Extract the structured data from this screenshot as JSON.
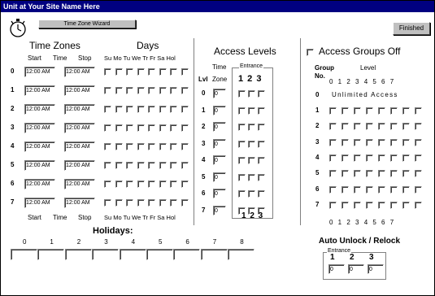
{
  "window": {
    "title": "Unit at Your Site Name Here"
  },
  "toolbar": {
    "wizard_label": "Time Zone Wizard",
    "finished_label": "Finished"
  },
  "time_zones": {
    "heading": "Time Zones",
    "days_heading": "Days",
    "col_start": "Start",
    "col_time": "Time",
    "col_stop": "Stop",
    "days_header": "Su Mo Tu We Tr Fr Sa Hol",
    "rows": [
      {
        "num": "0",
        "start": "12:00 AM",
        "stop": "12:00 AM"
      },
      {
        "num": "1",
        "start": "12:00 AM",
        "stop": "12:00 AM"
      },
      {
        "num": "2",
        "start": "12:00 AM",
        "stop": "12:00 AM"
      },
      {
        "num": "3",
        "start": "12:00 AM",
        "stop": "12:00 AM"
      },
      {
        "num": "4",
        "start": "12:00 AM",
        "stop": "12:00 AM"
      },
      {
        "num": "5",
        "start": "12:00 AM",
        "stop": "12:00 AM"
      },
      {
        "num": "6",
        "start": "12:00 AM",
        "stop": "12:00 AM"
      },
      {
        "num": "7",
        "start": "12:00 AM",
        "stop": "12:00 AM"
      }
    ]
  },
  "holidays": {
    "heading": "Holidays:",
    "indices": [
      "0",
      "1",
      "2",
      "3",
      "4",
      "5",
      "6",
      "7",
      "8"
    ]
  },
  "access_levels": {
    "heading": "Access Levels",
    "col_time": "Time",
    "col_lvl": "Lvl",
    "col_zone": "Zone",
    "entrance_label": "Entrance",
    "entrance_nums": "1 2 3",
    "rows": [
      {
        "lvl": "0",
        "zone": "0"
      },
      {
        "lvl": "1",
        "zone": "0"
      },
      {
        "lvl": "2",
        "zone": "0"
      },
      {
        "lvl": "3",
        "zone": "0"
      },
      {
        "lvl": "4",
        "zone": "0"
      },
      {
        "lvl": "5",
        "zone": "0"
      },
      {
        "lvl": "6",
        "zone": "0"
      },
      {
        "lvl": "7",
        "zone": "0"
      }
    ]
  },
  "access_groups": {
    "heading": "Access Groups Off",
    "group_label": "Group",
    "no_label": "No.",
    "level_label": "Level",
    "level_nums": "0 1 2 3 4 5 6 7",
    "row0_num": "0",
    "row0_text": "Unlimited Access",
    "rows": [
      "1",
      "2",
      "3",
      "4",
      "5",
      "6",
      "7"
    ]
  },
  "auto_unlock": {
    "heading": "Auto Unlock / Relock",
    "entrance_label": "Entrance",
    "entrance_nums": [
      "1",
      "2",
      "3"
    ],
    "values": [
      "0",
      "0",
      "0"
    ]
  }
}
